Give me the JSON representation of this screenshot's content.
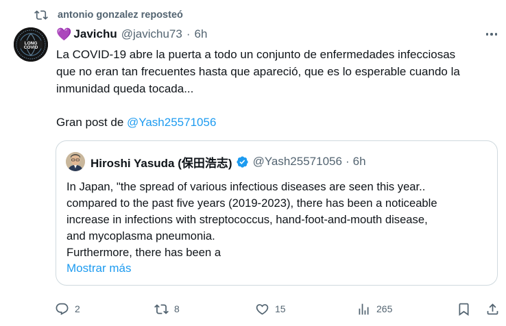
{
  "repost": {
    "label": "antonio gonzalez reposteó"
  },
  "post": {
    "emoji": "💜",
    "author_name": "Javichu",
    "handle": "@javichu73",
    "separator": "·",
    "time": "6h",
    "text_lines": [
      "La COVID-19 abre la puerta a todo un conjunto de enfermedades infecciosas",
      "que no eran tan frecuentes hasta que apareció, que es lo esperable cuando la",
      "inmunidad queda tocada..."
    ],
    "gran_prefix": "Gran post de ",
    "gran_mention": "@Yash25571056",
    "avatar_text": {
      "top": "LONG",
      "bottom": "COVID"
    }
  },
  "quote": {
    "author_name": "Hiroshi Yasuda (保田浩志)",
    "handle": "@Yash25571056",
    "separator": "·",
    "time": "6h",
    "text_lines": [
      "In Japan, \"the spread of various infectious diseases are seen this year..",
      "compared to the past five years (2019-2023), there has been a noticeable",
      "increase in infections with streptococcus, hand-foot-and-mouth disease,",
      "and mycoplasma pneumonia.",
      "Furthermore, there has been a"
    ],
    "show_more": "Mostrar más"
  },
  "actions": {
    "replies": "2",
    "reposts": "8",
    "likes": "15",
    "views": "265"
  },
  "colors": {
    "accent": "#1d9bf0",
    "muted": "#536471",
    "border": "#cfd9de"
  }
}
